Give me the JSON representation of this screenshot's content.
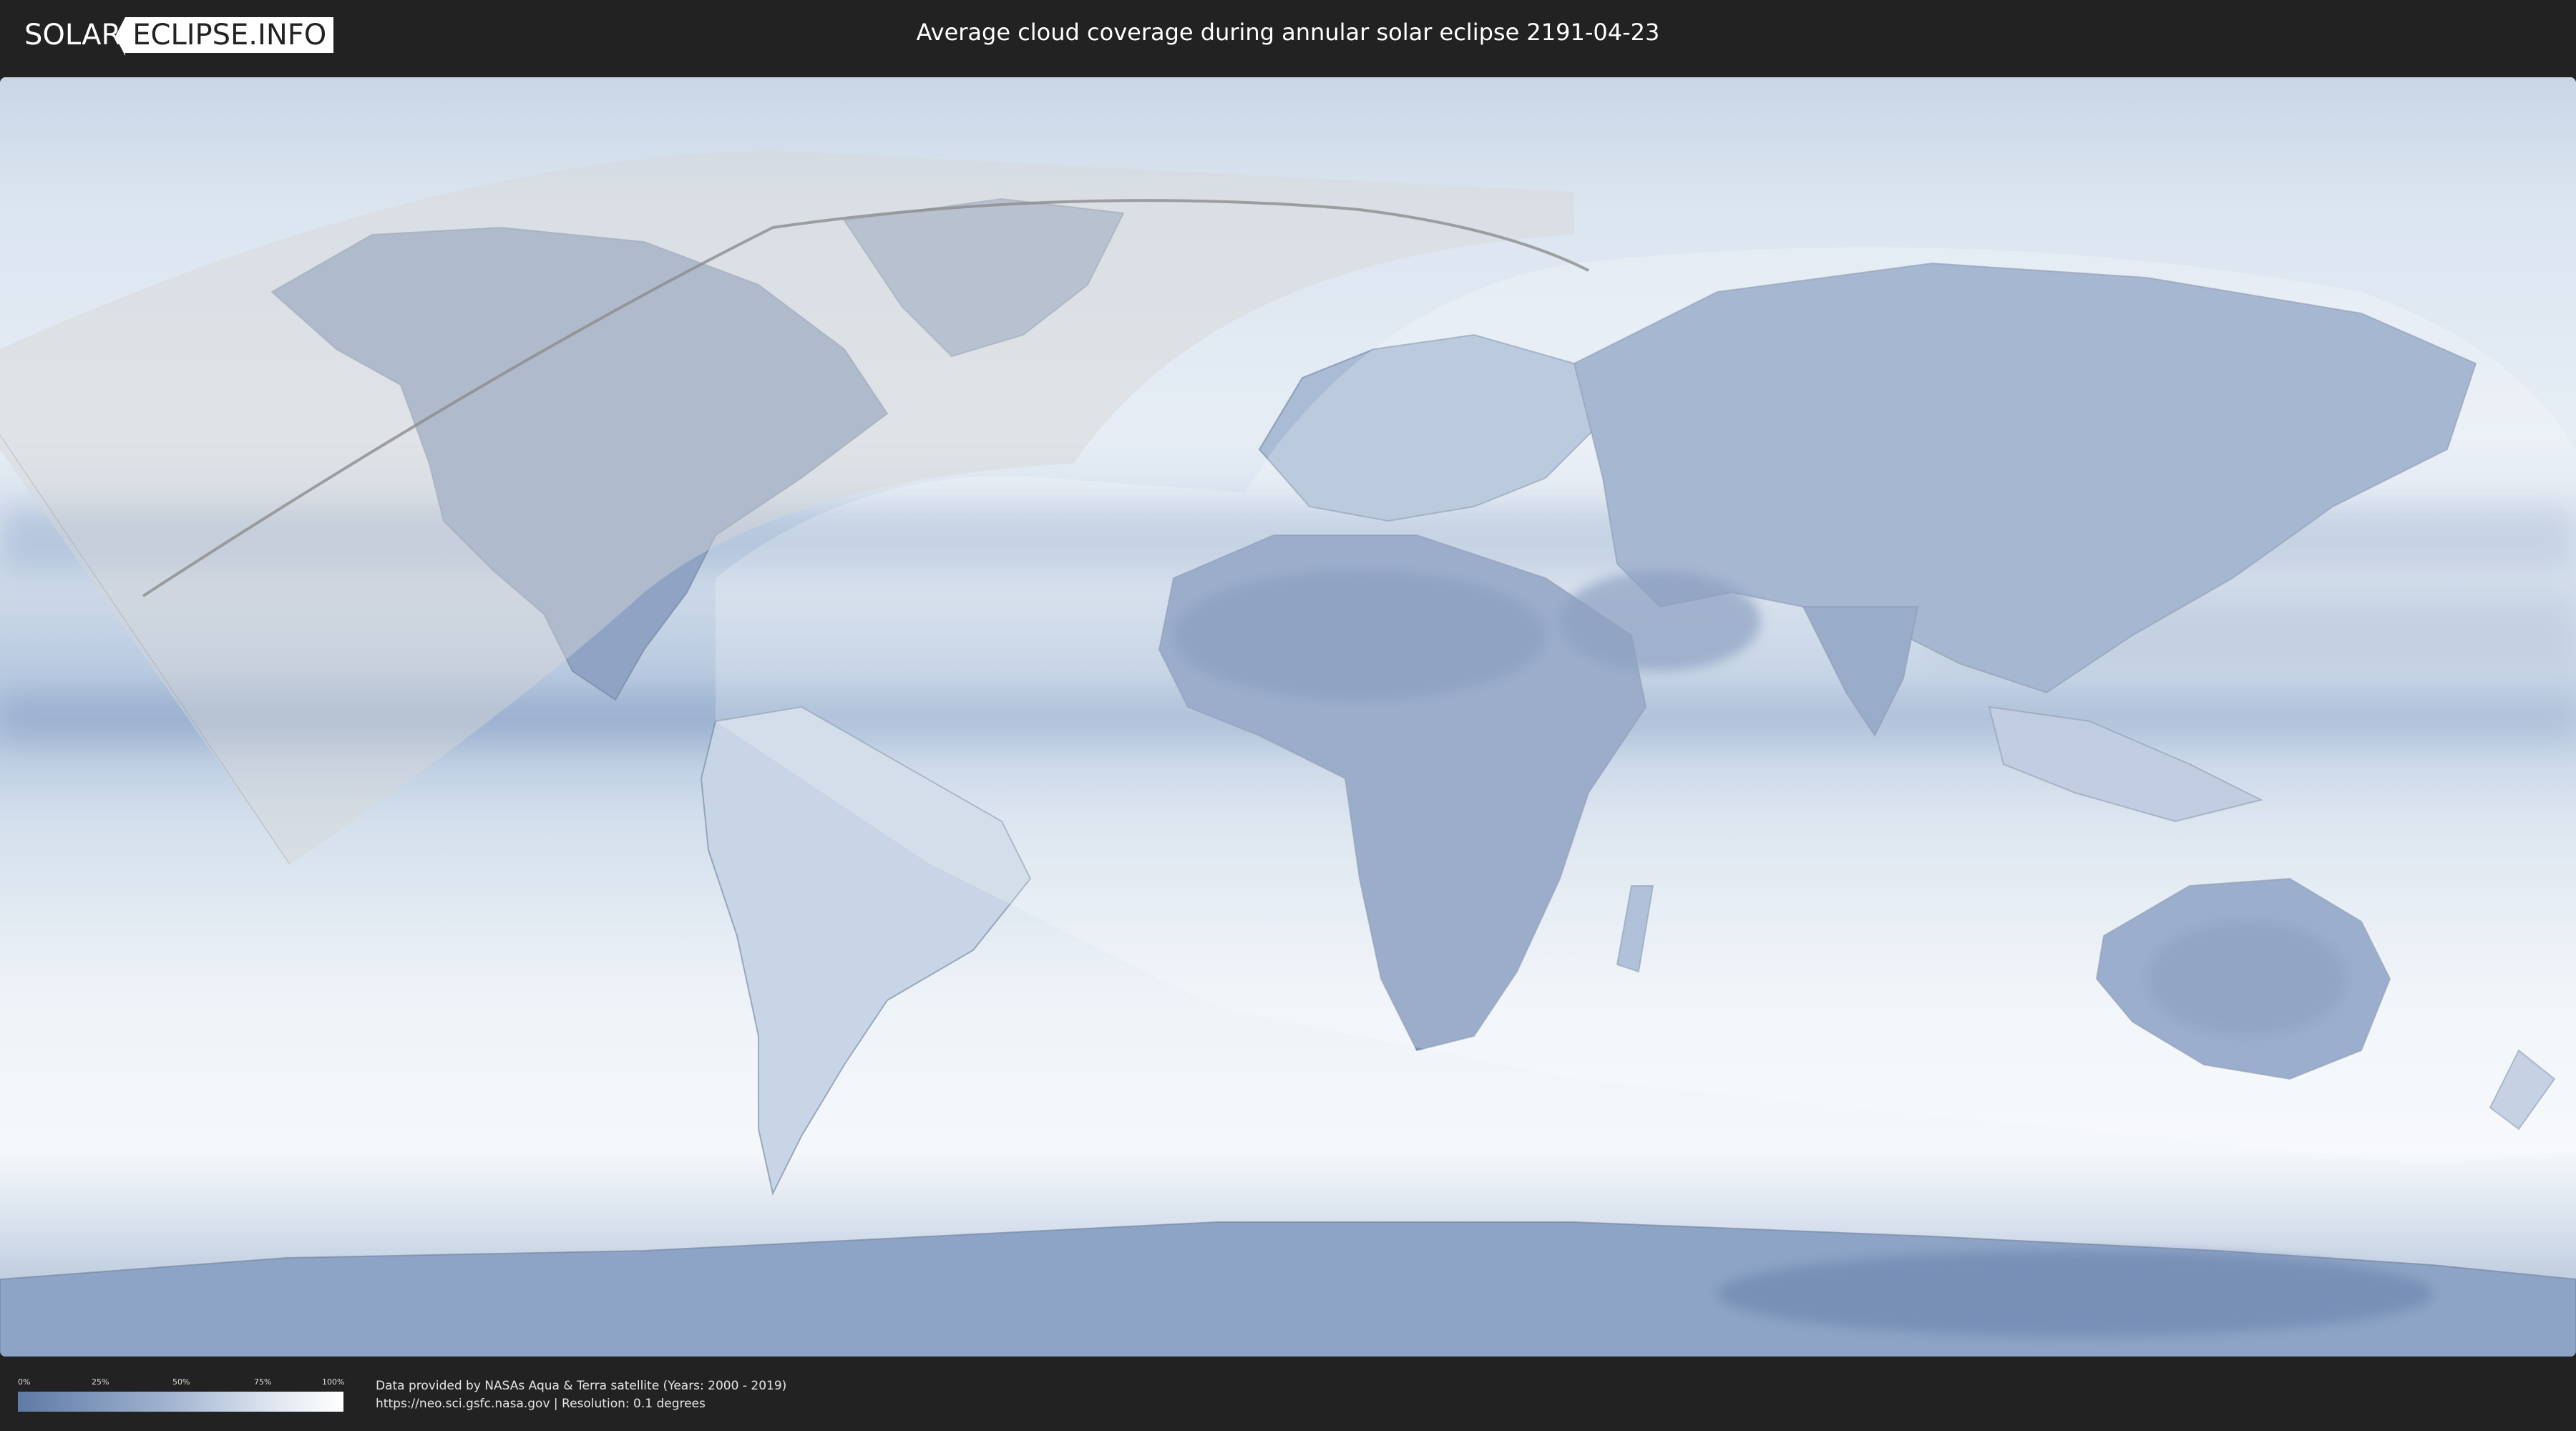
{
  "header": {
    "logo_part1": "SOLAR",
    "logo_part2": "ECLIPSE.INFO",
    "title": "Average cloud coverage during annular solar eclipse 2191-04-23"
  },
  "legend": {
    "ticks": [
      "0%",
      "25%",
      "50%",
      "75%",
      "100%"
    ],
    "colors": {
      "clear": "#5f7aa6",
      "cloudy": "#ffffff"
    }
  },
  "footer": {
    "credit_line1": "Data provided by NASAs Aqua & Terra satellite (Years: 2000 - 2019)",
    "credit_line2": "https://neo.sci.gsfc.nasa.gov | Resolution: 0.1 degrees"
  },
  "map": {
    "projection": "equirectangular world map",
    "colors": {
      "land_clear": "#7b93bb",
      "ocean_cloudy": "#dfe8f2",
      "eclipse_overlay": "#ffffff",
      "night_overlay": "#c8c8c8"
    }
  }
}
